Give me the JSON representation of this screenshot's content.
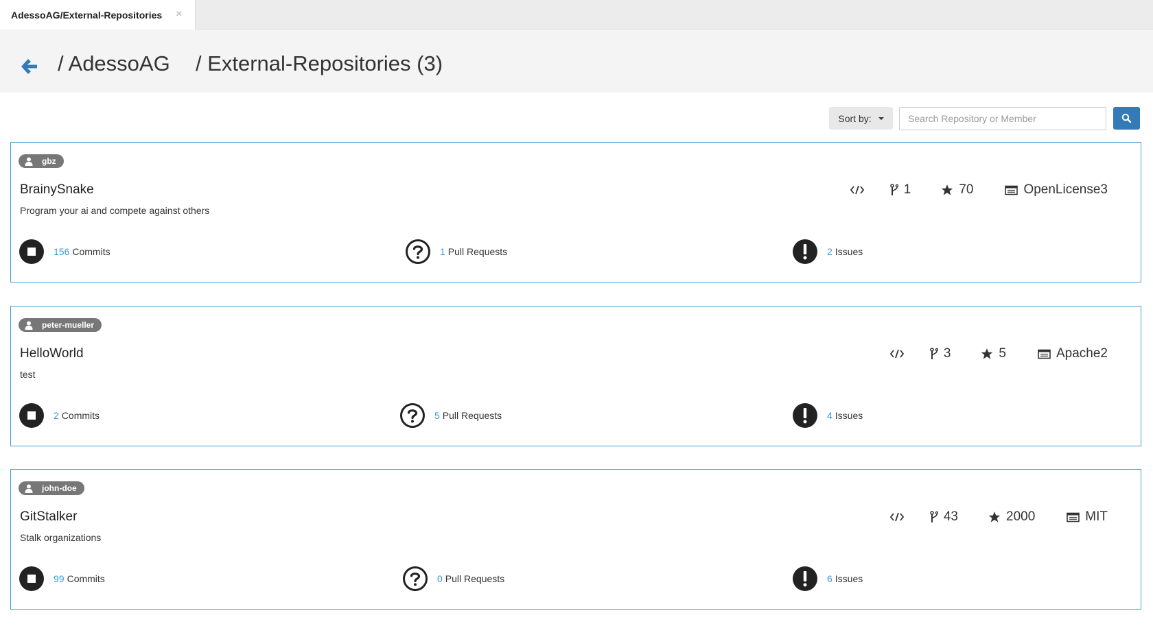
{
  "tab": {
    "title": "AdessoAG/External-Repositories",
    "close": "×"
  },
  "header": {
    "back_icon": "arrow-left-icon",
    "org": "/ AdessoAG",
    "repo_group": "/ External-Repositories",
    "count": "(3)"
  },
  "toolbar": {
    "sort_label": "Sort by:",
    "search_placeholder": "Search Repository or Member",
    "search_icon": "search-icon"
  },
  "colors": {
    "accent": "#337ab7",
    "card_border": "#3aa0c8",
    "link": "#3a9ad9",
    "badge": "#777777"
  },
  "repos": [
    {
      "owner": "gbz",
      "name": "BrainySnake",
      "description": "Program your ai and compete against others",
      "forks": "1",
      "stars": "70",
      "license": "OpenLicense3",
      "commits": "156",
      "commits_label": "Commits",
      "pull_requests": "1",
      "pull_requests_label": "Pull Requests",
      "issues": "2",
      "issues_label": "Issues"
    },
    {
      "owner": "peter-mueller",
      "name": "HelloWorld",
      "description": "test",
      "forks": "3",
      "stars": "5",
      "license": "Apache2",
      "commits": "2",
      "commits_label": "Commits",
      "pull_requests": "5",
      "pull_requests_label": "Pull Requests",
      "issues": "4",
      "issues_label": "Issues"
    },
    {
      "owner": "john-doe",
      "name": "GitStalker",
      "description": "Stalk organizations",
      "forks": "43",
      "stars": "2000",
      "license": "MIT",
      "commits": "99",
      "commits_label": "Commits",
      "pull_requests": "0",
      "pull_requests_label": "Pull Requests",
      "issues": "6",
      "issues_label": "Issues"
    }
  ]
}
